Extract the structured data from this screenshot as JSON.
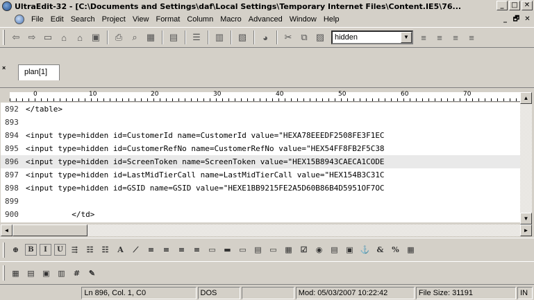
{
  "window": {
    "title": "UltraEdit-32 - [C:\\Documents and Settings\\daf\\Local Settings\\Temporary Internet Files\\Content.IE5\\76...",
    "minimize": "_",
    "maximize": "□",
    "close": "✕"
  },
  "menubar": {
    "items": [
      "File",
      "Edit",
      "Search",
      "Project",
      "View",
      "Format",
      "Column",
      "Macro",
      "Advanced",
      "Window",
      "Help"
    ],
    "mdi_minimize": "_",
    "mdi_restore": "🗗",
    "mdi_close": "✕"
  },
  "toolbar": {
    "search_combo_value": "hidden"
  },
  "tabs": [
    {
      "label": "plan[1]",
      "active": true
    }
  ],
  "tab_close": "×",
  "ruler": {
    "labels": [
      "0",
      "10",
      "20",
      "30",
      "40",
      "50",
      "60",
      "70"
    ]
  },
  "editor": {
    "current_line": 896,
    "lines": [
      {
        "no": "892",
        "text": "</table>"
      },
      {
        "no": "893",
        "text": ""
      },
      {
        "no": "894",
        "text": "<input type=hidden id=CustomerId name=CustomerId value=\"HEXA78EEEDF2508FE3F1EC"
      },
      {
        "no": "895",
        "text": "<input type=hidden id=CustomerRefNo name=CustomerRefNo value=\"HEX54FF8FB2F5C38"
      },
      {
        "no": "896",
        "text": "<input type=hidden id=ScreenToken name=ScreenToken value=\"HEX15B8943CAECA1CODE"
      },
      {
        "no": "897",
        "text": "<input type=hidden id=LastMidTierCall name=LastMidTierCall value=\"HEX154B3C31C"
      },
      {
        "no": "898",
        "text": "<input type=hidden id=GSID name=GSID value=\"HEXE1BB9215FE2A5D60B86B4D5951OF7OC"
      },
      {
        "no": "899",
        "text": ""
      },
      {
        "no": "900",
        "text": "          </td>"
      }
    ]
  },
  "statusbar": {
    "position": "Ln 896, Col. 1, C0",
    "format": "DOS",
    "modified": "Mod: 05/03/2007 10:22:42",
    "file_size": "File Size: 31191",
    "mode": "IN"
  },
  "colors": {
    "chrome": "#d4d0c8",
    "editor_bg": "#ffffff",
    "current_line": "#e9e9e9"
  }
}
